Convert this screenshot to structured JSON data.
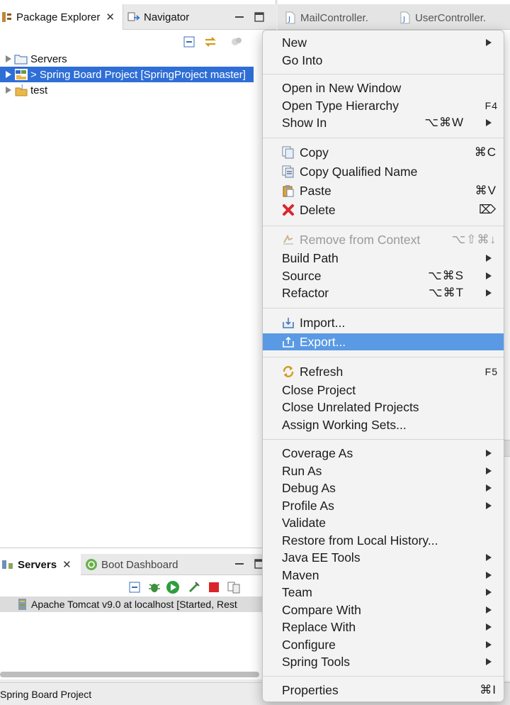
{
  "package_explorer": {
    "tab_label": "Package Explorer",
    "navigator_label": "Navigator",
    "tree": [
      {
        "label": "Servers",
        "selected": false
      },
      {
        "label": "> Spring Board Project [SpringProject master]",
        "selected": true
      },
      {
        "label": "test",
        "selected": false
      }
    ]
  },
  "servers_view": {
    "tab_label": "Servers",
    "boot_label": "Boot Dashboard",
    "server_row": "Apache Tomcat v9.0  at localhost  [Started, Rest"
  },
  "editor": {
    "tabs": [
      "MailController.",
      "UserController."
    ]
  },
  "status_bar": {
    "text": "Spring Board Project"
  },
  "context_menu": {
    "items": [
      {
        "label": "New",
        "shortcut": "",
        "submenu": true
      },
      {
        "label": "Go Into",
        "shortcut": "",
        "submenu": false
      },
      {
        "label": "Open in New Window",
        "shortcut": "",
        "submenu": false
      },
      {
        "label": "Open Type Hierarchy",
        "shortcut": "F4",
        "submenu": false
      },
      {
        "label": "Show In",
        "shortcut": "⌥⌘W",
        "submenu": true
      },
      {
        "label": "Copy",
        "shortcut": "⌘C",
        "icon": "copy-icon"
      },
      {
        "label": "Copy Qualified Name",
        "shortcut": "",
        "icon": "copy-qualified-name-icon"
      },
      {
        "label": "Paste",
        "shortcut": "⌘V",
        "icon": "paste-icon"
      },
      {
        "label": "Delete",
        "shortcut": "⌦",
        "icon": "delete-icon"
      },
      {
        "label": "Remove from Context",
        "shortcut": "⌥⇧⌘↓",
        "icon": "remove-context-icon",
        "disabled": true
      },
      {
        "label": "Build Path",
        "shortcut": "",
        "submenu": true
      },
      {
        "label": "Source",
        "shortcut": "⌥⌘S",
        "submenu": true
      },
      {
        "label": "Refactor",
        "shortcut": "⌥⌘T",
        "submenu": true
      },
      {
        "label": "Import...",
        "shortcut": "",
        "icon": "import-icon"
      },
      {
        "label": "Export...",
        "shortcut": "",
        "icon": "export-icon",
        "highlighted": true
      },
      {
        "label": "Refresh",
        "shortcut": "F5",
        "icon": "refresh-icon"
      },
      {
        "label": "Close Project",
        "shortcut": ""
      },
      {
        "label": "Close Unrelated Projects",
        "shortcut": ""
      },
      {
        "label": "Assign Working Sets...",
        "shortcut": ""
      },
      {
        "label": "Coverage As",
        "submenu": true
      },
      {
        "label": "Run As",
        "submenu": true
      },
      {
        "label": "Debug As",
        "submenu": true
      },
      {
        "label": "Profile As",
        "submenu": true
      },
      {
        "label": "Validate"
      },
      {
        "label": "Restore from Local History..."
      },
      {
        "label": "Java EE Tools",
        "submenu": true
      },
      {
        "label": "Maven",
        "submenu": true
      },
      {
        "label": "Team",
        "submenu": true
      },
      {
        "label": "Compare With",
        "submenu": true
      },
      {
        "label": "Replace With",
        "submenu": true
      },
      {
        "label": "Configure",
        "submenu": true
      },
      {
        "label": "Spring Tools",
        "submenu": true
      },
      {
        "label": "Properties",
        "shortcut": "⌘I"
      }
    ]
  },
  "colors": {
    "selection": "#2f6ed6",
    "menu_highlight": "#5a9ae4"
  }
}
